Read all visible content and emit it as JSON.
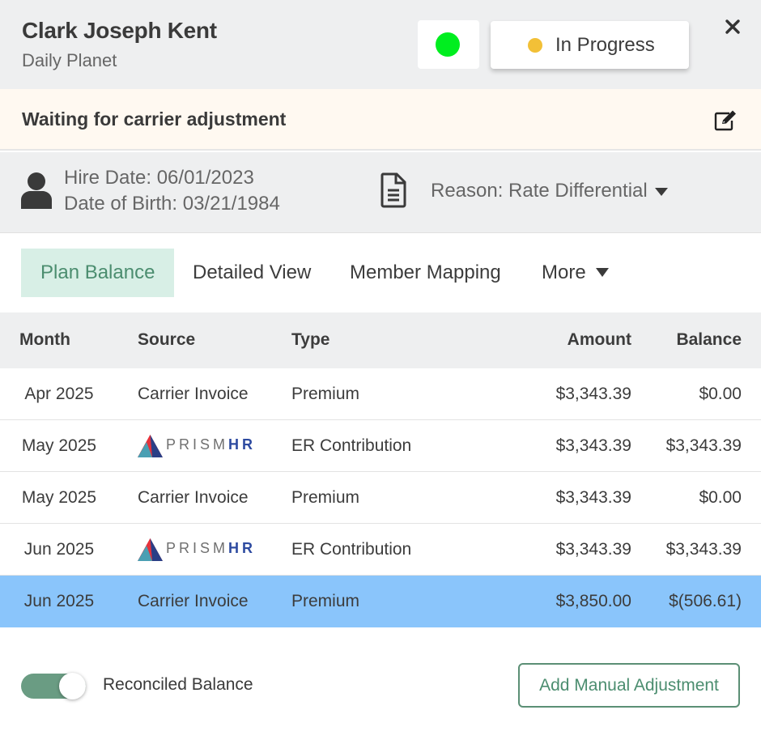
{
  "header": {
    "name": "Clark Joseph Kent",
    "company": "Daily Planet",
    "status_label": "In Progress",
    "status_dot_color": "#f2c037",
    "indicator_color": "#00ee1f"
  },
  "banner": {
    "text": "Waiting for carrier adjustment"
  },
  "info": {
    "hire_date": "Hire Date: 06/01/2023",
    "dob": "Date of Birth: 03/21/1984",
    "reason": "Reason: Rate Differential"
  },
  "tabs": [
    {
      "label": "Plan Balance",
      "active": true
    },
    {
      "label": "Detailed View",
      "active": false
    },
    {
      "label": "Member Mapping",
      "active": false
    },
    {
      "label": "More",
      "active": false
    }
  ],
  "table": {
    "columns": [
      "Month",
      "Source",
      "Type",
      "Amount",
      "Balance"
    ],
    "rows": [
      {
        "month": "Apr 2025",
        "source": "Carrier Invoice",
        "type": "Premium",
        "amount": "$3,343.39",
        "balance": "$0.00"
      },
      {
        "month": "May 2025",
        "source": "PRISMHR",
        "type": "ER Contribution",
        "amount": "$3,343.39",
        "balance": "$3,343.39"
      },
      {
        "month": "May 2025",
        "source": "Carrier Invoice",
        "type": "Premium",
        "amount": "$3,343.39",
        "balance": "$0.00"
      },
      {
        "month": "Jun 2025",
        "source": "PRISMHR",
        "type": "ER Contribution",
        "amount": "$3,343.39",
        "balance": "$3,343.39"
      },
      {
        "month": "Jun 2025",
        "source": "Carrier Invoice",
        "type": "Premium",
        "amount": "$3,850.00",
        "balance": "$(506.61)"
      }
    ],
    "prism_logo": {
      "part1": "PRISM",
      "part2": "HR"
    }
  },
  "footer": {
    "toggle_label": "Reconciled Balance",
    "toggle_on": true,
    "add_button": "Add Manual Adjustment"
  },
  "icons": {
    "close": "close-icon",
    "edit": "edit-icon",
    "person": "person-icon",
    "document": "document-icon",
    "caret": "caret-down-icon"
  },
  "colors": {
    "accent_green": "#4b8d6f",
    "selected_row": "#8ac5fb",
    "banner_bg": "#fff9f1"
  }
}
